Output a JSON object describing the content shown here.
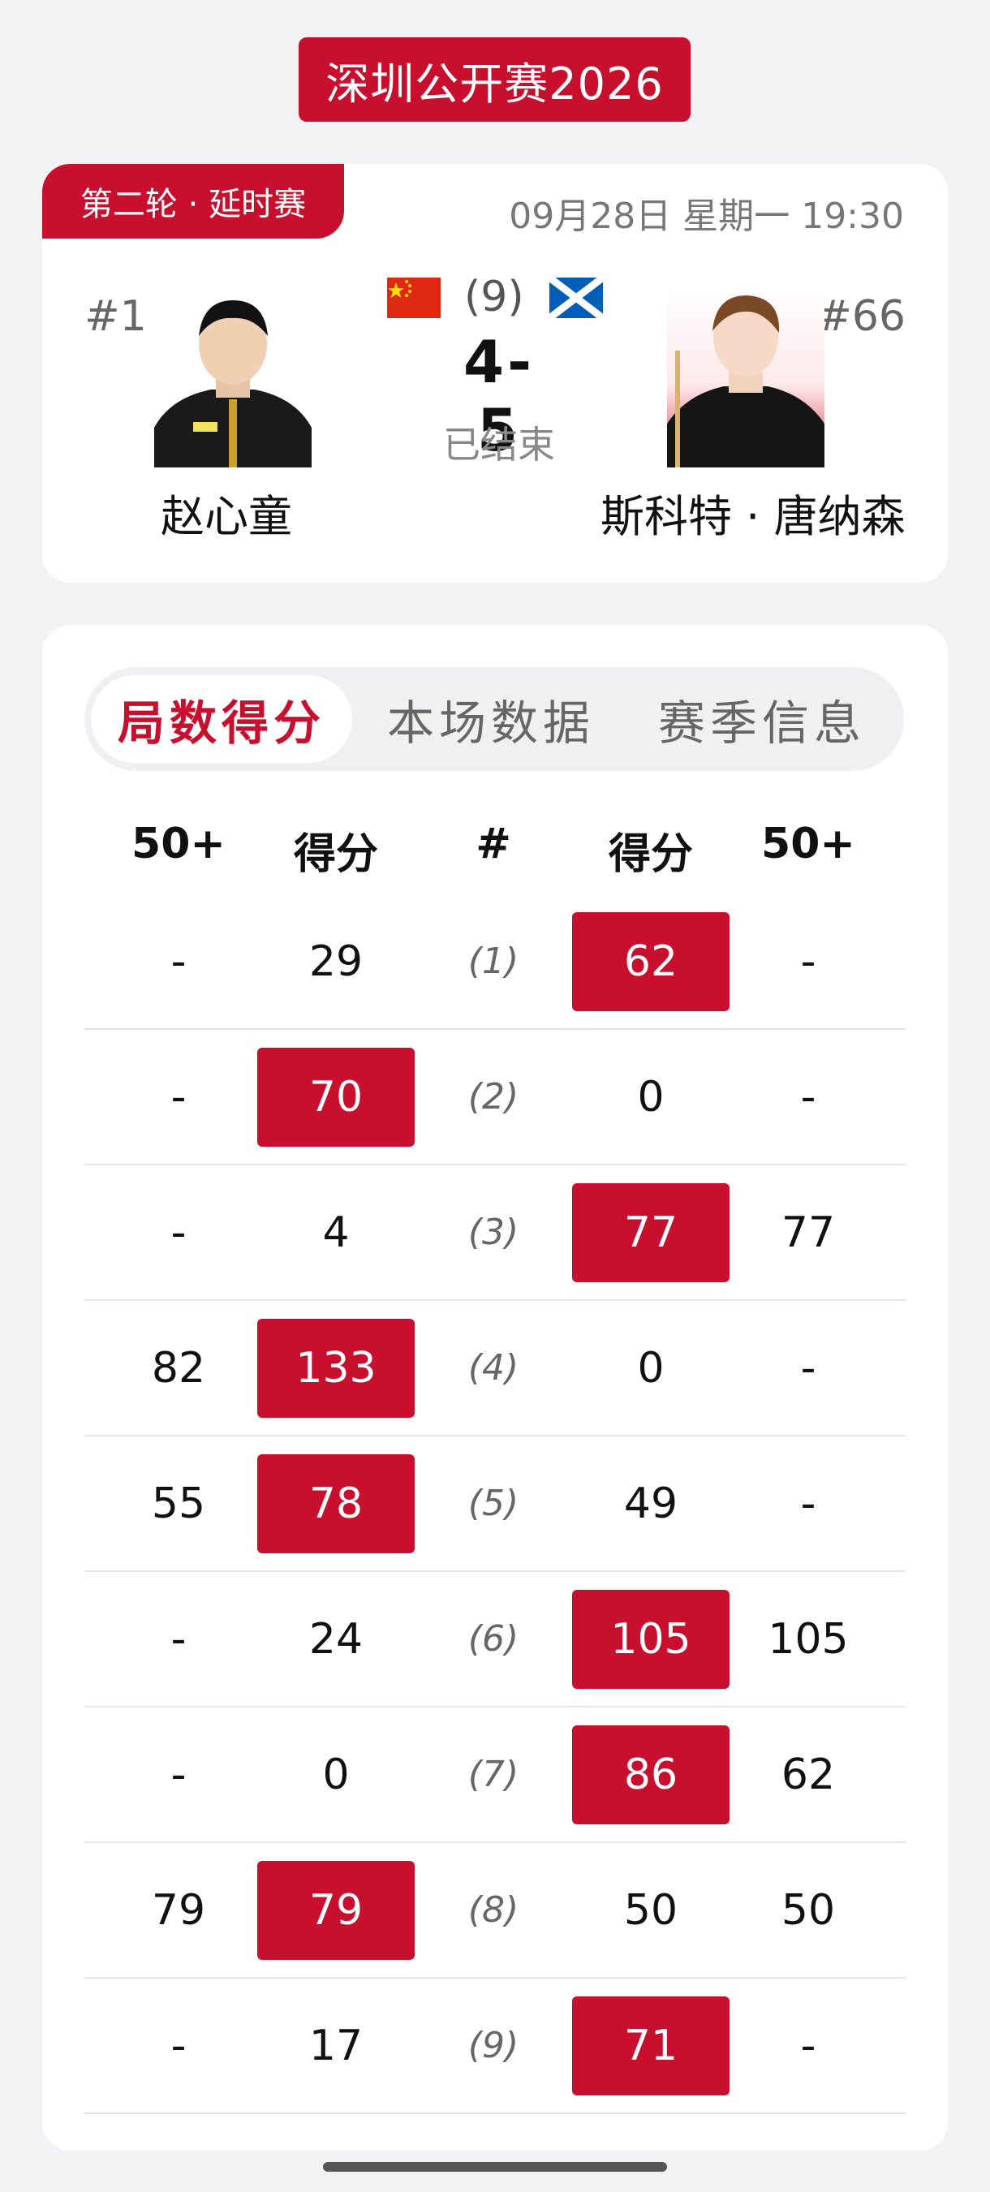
{
  "header": {
    "title": "深圳公开赛2026"
  },
  "match": {
    "round": "第二轮 · 延时赛",
    "datetime": "09月28日 星期一 19:30",
    "best_of": "(9)",
    "score": "4-5",
    "status": "已结束",
    "player1": {
      "rank": "#1",
      "name": "赵心童",
      "flag": "china-flag-icon"
    },
    "player2": {
      "rank": "#66",
      "name": "斯科特 · 唐纳森",
      "flag": "scotland-flag-icon"
    }
  },
  "tabs": [
    {
      "label": "局数得分",
      "active": true
    },
    {
      "label": "本场数据",
      "active": false
    },
    {
      "label": "赛季信息",
      "active": false
    }
  ],
  "table": {
    "headers": [
      "50+",
      "得分",
      "#",
      "得分",
      "50+"
    ],
    "rows": [
      {
        "p1_50": "-",
        "p1_score": "29",
        "frame": "(1)",
        "p2_score": "62",
        "p2_50": "-",
        "winner": "p2"
      },
      {
        "p1_50": "-",
        "p1_score": "70",
        "frame": "(2)",
        "p2_score": "0",
        "p2_50": "-",
        "winner": "p1"
      },
      {
        "p1_50": "-",
        "p1_score": "4",
        "frame": "(3)",
        "p2_score": "77",
        "p2_50": "77",
        "winner": "p2"
      },
      {
        "p1_50": "82",
        "p1_score": "133",
        "frame": "(4)",
        "p2_score": "0",
        "p2_50": "-",
        "winner": "p1"
      },
      {
        "p1_50": "55",
        "p1_score": "78",
        "frame": "(5)",
        "p2_score": "49",
        "p2_50": "-",
        "winner": "p1"
      },
      {
        "p1_50": "-",
        "p1_score": "24",
        "frame": "(6)",
        "p2_score": "105",
        "p2_50": "105",
        "winner": "p2"
      },
      {
        "p1_50": "-",
        "p1_score": "0",
        "frame": "(7)",
        "p2_score": "86",
        "p2_50": "62",
        "winner": "p2"
      },
      {
        "p1_50": "79",
        "p1_score": "79",
        "frame": "(8)",
        "p2_score": "50",
        "p2_50": "50",
        "winner": "p1"
      },
      {
        "p1_50": "-",
        "p1_score": "17",
        "frame": "(9)",
        "p2_score": "71",
        "p2_50": "-",
        "winner": "p2"
      }
    ]
  },
  "colors": {
    "accent": "#c8102e",
    "background": "#f2f2f4",
    "card": "#ffffff"
  }
}
